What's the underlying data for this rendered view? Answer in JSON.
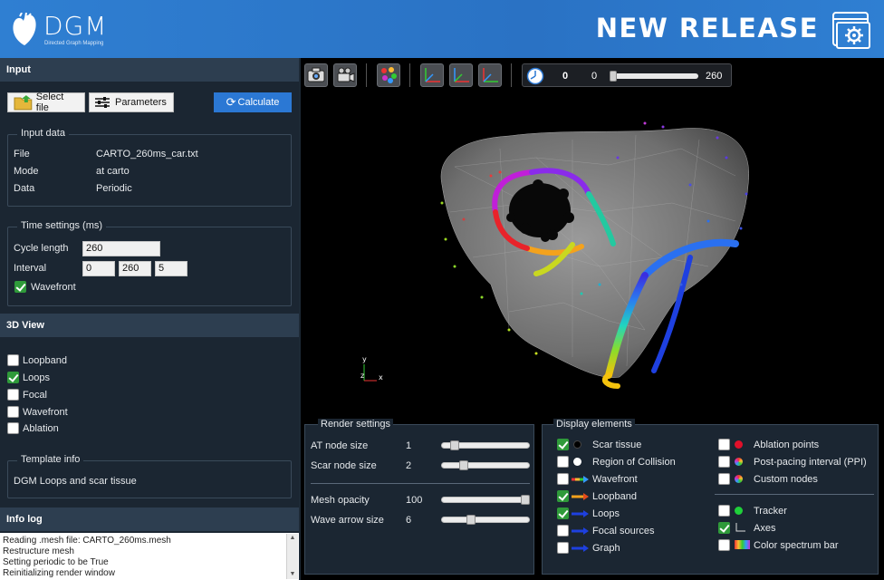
{
  "header": {
    "logo_text": "DGM",
    "logo_subtitle": "Directed Graph Mapping",
    "release_text": "NEW RELEASE"
  },
  "input": {
    "section_title": "Input",
    "select_file_label": "Select file",
    "parameters_label": "Parameters",
    "calculate_label": "Calculate",
    "input_data": {
      "title": "Input data",
      "rows": [
        {
          "label": "File",
          "value": "CARTO_260ms_car.txt"
        },
        {
          "label": "Mode",
          "value": "at carto"
        },
        {
          "label": "Data",
          "value": "Periodic"
        }
      ]
    },
    "time_settings": {
      "title": "Time settings (ms)",
      "cycle_length_label": "Cycle length",
      "cycle_length_value": "260",
      "interval_label": "Interval",
      "interval_values": [
        "0",
        "260",
        "5"
      ],
      "wavefront_label": "Wavefront",
      "wavefront_checked": true
    }
  },
  "view3d": {
    "section_title": "3D View",
    "options": [
      {
        "label": "Loopband",
        "checked": false
      },
      {
        "label": "Loops",
        "checked": true
      },
      {
        "label": "Focal",
        "checked": false
      },
      {
        "label": "Wavefront",
        "checked": false
      },
      {
        "label": "Ablation",
        "checked": false
      }
    ],
    "template_info": {
      "title": "Template info",
      "text": "DGM Loops and scar tissue"
    }
  },
  "infolog": {
    "section_title": "Info log",
    "lines": [
      "Reading .mesh file: CARTO_260ms.mesh",
      "Restructure mesh",
      "Setting periodic to be True",
      "Reinitializing render window"
    ]
  },
  "toolbar": {
    "buttons": [
      "camera-icon",
      "video-camera-icon",
      "color-dots-icon",
      "axes-xy-icon",
      "axes-zx-icon",
      "axes-yz-icon"
    ],
    "time_display": "0",
    "slider_min": "0",
    "slider_max": "260",
    "slider_position": 0
  },
  "render_settings": {
    "title": "Render settings",
    "rows": [
      {
        "label": "AT node size",
        "value": "1",
        "level": 0.12
      },
      {
        "label": "Scar node size",
        "value": "2",
        "level": 0.22
      },
      {
        "label": "Mesh opacity",
        "value": "100",
        "level": 1.0
      },
      {
        "label": "Wave arrow size",
        "value": "6",
        "level": 0.3
      }
    ]
  },
  "display_elements": {
    "title": "Display elements",
    "left": [
      {
        "label": "Scar tissue",
        "checked": true,
        "icon": "black-dot-icon"
      },
      {
        "label": "Region of Collision",
        "checked": false,
        "icon": "white-dot-icon"
      },
      {
        "label": "Wavefront",
        "checked": false,
        "icon": "rainbow-arrow-icon"
      },
      {
        "label": "Loopband",
        "checked": true,
        "icon": "orange-arrow-icon"
      },
      {
        "label": "Loops",
        "checked": true,
        "icon": "blue-arrow-icon"
      },
      {
        "label": "Focal sources",
        "checked": false,
        "icon": "blue-arrow-icon"
      },
      {
        "label": "Graph",
        "checked": false,
        "icon": "blue-arrow-icon"
      }
    ],
    "right": [
      {
        "label": "Ablation points",
        "checked": false,
        "icon": "red-dot-icon"
      },
      {
        "label": "Post-pacing interval (PPI)",
        "checked": false,
        "icon": "rainbow-circle-icon"
      },
      {
        "label": "Custom nodes",
        "checked": false,
        "icon": "rainbow-circle-icon"
      },
      {
        "label": "Tracker",
        "checked": false,
        "icon": "green-dot-icon"
      },
      {
        "label": "Axes",
        "checked": true,
        "icon": "axes-icon"
      },
      {
        "label": "Color spectrum bar",
        "checked": false,
        "icon": "spectrum-icon"
      }
    ]
  },
  "colors": {
    "header_blue": "#2f7fd2",
    "panel_bg": "#1b2632",
    "section_bg": "#2d3e50",
    "check_green": "#2f9a3a",
    "calculate_blue": "#2b78d4"
  }
}
